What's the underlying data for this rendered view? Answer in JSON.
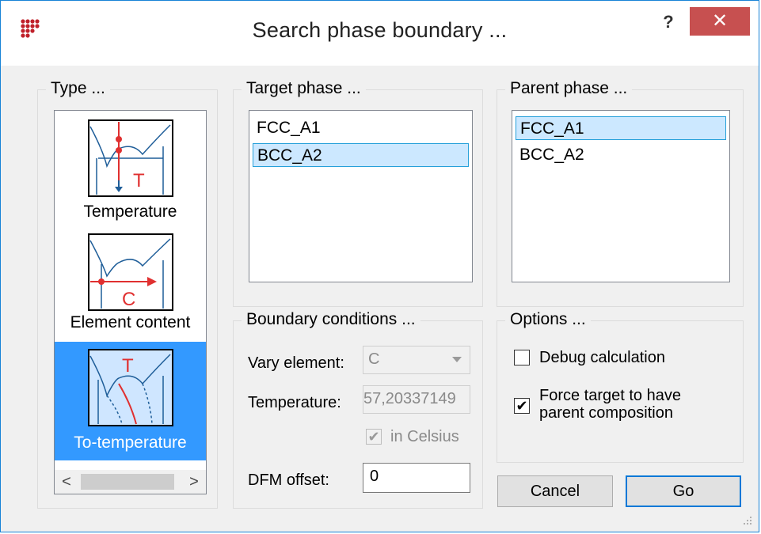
{
  "window": {
    "title": "Search  phase boundary ...",
    "help_label": "?",
    "close_label": "✕"
  },
  "type_group": {
    "label": "Type ...",
    "items": [
      {
        "label": "Temperature",
        "icon": "temperature-diagram-icon",
        "letter": "T"
      },
      {
        "label": "Element content",
        "icon": "element-content-diagram-icon",
        "letter": "C"
      },
      {
        "label": "To-temperature",
        "icon": "to-temperature-diagram-icon",
        "letter": "T",
        "selected": true
      }
    ],
    "scroll_left": "<",
    "scroll_right": ">"
  },
  "target_phase": {
    "label": "Target phase ...",
    "items": [
      "FCC_A1",
      "BCC_A2"
    ],
    "selected": "BCC_A2"
  },
  "parent_phase": {
    "label": "Parent phase ...",
    "items": [
      "FCC_A1",
      "BCC_A2"
    ],
    "selected": "FCC_A1"
  },
  "boundary": {
    "label": "Boundary conditions ...",
    "vary_element_label": "Vary element:",
    "vary_element_value": "C",
    "temperature_label": "Temperature:",
    "temperature_value": "57,20337149",
    "celsius_label": "in Celsius",
    "celsius_checked": true,
    "dfm_label": "DFM offset:",
    "dfm_value": "0"
  },
  "options": {
    "label": "Options ...",
    "debug_label": "Debug calculation",
    "debug_checked": false,
    "force_label_line1": "Force target to have",
    "force_label_line2": "parent composition",
    "force_checked": true
  },
  "buttons": {
    "cancel": "Cancel",
    "go": "Go"
  },
  "colors": {
    "selection": "#3399ff",
    "list_selection": "#cce8ff",
    "close": "#c75050",
    "diagram_red": "#e03030",
    "diagram_blue": "#1f5e99"
  }
}
